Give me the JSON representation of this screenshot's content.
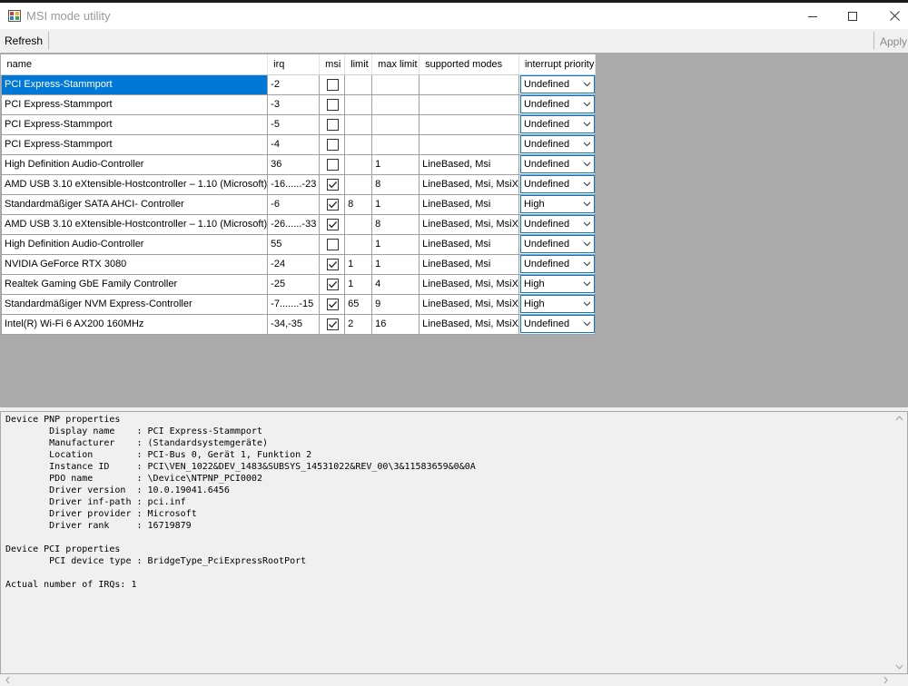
{
  "window": {
    "title": "MSI mode utility"
  },
  "toolbar": {
    "refresh_label": "Refresh",
    "apply_label": "Apply"
  },
  "columns": [
    "name",
    "irq",
    "msi",
    "limit",
    "max limit",
    "supported modes",
    "interrupt priority"
  ],
  "rows": [
    {
      "name": "PCI Express-Stammport",
      "irq": "-2",
      "msi": false,
      "limit": "",
      "max_limit": "",
      "modes": "",
      "priority": "Undefined"
    },
    {
      "name": "PCI Express-Stammport",
      "irq": "-3",
      "msi": false,
      "limit": "",
      "max_limit": "",
      "modes": "",
      "priority": "Undefined"
    },
    {
      "name": "PCI Express-Stammport",
      "irq": "-5",
      "msi": false,
      "limit": "",
      "max_limit": "",
      "modes": "",
      "priority": "Undefined"
    },
    {
      "name": "PCI Express-Stammport",
      "irq": "-4",
      "msi": false,
      "limit": "",
      "max_limit": "",
      "modes": "",
      "priority": "Undefined"
    },
    {
      "name": "High Definition Audio-Controller",
      "irq": "36",
      "msi": false,
      "limit": "",
      "max_limit": "1",
      "modes": "LineBased, Msi",
      "priority": "Undefined"
    },
    {
      "name": "AMD USB 3.10 eXtensible-Hostcontroller – 1.10 (Microsoft)",
      "irq": "-16......-23",
      "msi": true,
      "limit": "",
      "max_limit": "8",
      "modes": "LineBased, Msi, MsiX",
      "priority": "Undefined"
    },
    {
      "name": "Standardmäßiger SATA AHCI- Controller",
      "irq": "-6",
      "msi": true,
      "limit": "8",
      "max_limit": "1",
      "modes": "LineBased, Msi",
      "priority": "High"
    },
    {
      "name": "AMD USB 3.10 eXtensible-Hostcontroller – 1.10 (Microsoft)",
      "irq": "-26......-33",
      "msi": true,
      "limit": "",
      "max_limit": "8",
      "modes": "LineBased, Msi, MsiX",
      "priority": "Undefined"
    },
    {
      "name": "High Definition Audio-Controller",
      "irq": "55",
      "msi": false,
      "limit": "",
      "max_limit": "1",
      "modes": "LineBased, Msi",
      "priority": "Undefined"
    },
    {
      "name": "NVIDIA GeForce RTX 3080",
      "irq": "-24",
      "msi": true,
      "limit": "1",
      "max_limit": "1",
      "modes": "LineBased, Msi",
      "priority": "Undefined"
    },
    {
      "name": "Realtek Gaming GbE Family Controller",
      "irq": "-25",
      "msi": true,
      "limit": "1",
      "max_limit": "4",
      "modes": "LineBased, Msi, MsiX",
      "priority": "High"
    },
    {
      "name": "Standardmäßiger NVM Express-Controller",
      "irq": "-7.......-15",
      "msi": true,
      "limit": "65",
      "max_limit": "9",
      "modes": "LineBased, Msi, MsiX",
      "priority": "High"
    },
    {
      "name": "Intel(R) Wi-Fi 6 AX200 160MHz",
      "irq": "-34,-35",
      "msi": true,
      "limit": "2",
      "max_limit": "16",
      "modes": "LineBased, Msi, MsiX",
      "priority": "Undefined"
    }
  ],
  "details_text": "Device PNP properties\n        Display name    : PCI Express-Stammport\n        Manufacturer    : (Standardsystemgeräte)\n        Location        : PCI-Bus 0, Gerät 1, Funktion 2\n        Instance ID     : PCI\\VEN_1022&DEV_1483&SUBSYS_14531022&REV_00\\3&11583659&0&0A\n        PDO name        : \\Device\\NTPNP_PCI0002\n        Driver version  : 10.0.19041.6456\n        Driver inf-path : pci.inf\n        Driver provider : Microsoft\n        Driver rank     : 16719879\n\nDevice PCI properties\n        PCI device type : BridgeType_PciExpressRootPort\n\nActual number of IRQs: 1",
  "colors": {
    "selection": "#0078d7",
    "grid_background": "#ababab",
    "border": "#a0a0a0"
  },
  "icons": [
    "app-icon",
    "minimize-icon",
    "maximize-icon",
    "close-icon",
    "checkbox-checked-icon",
    "chevron-down-icon",
    "scroll-up-icon",
    "scroll-down-icon",
    "scroll-left-icon",
    "scroll-right-icon"
  ]
}
